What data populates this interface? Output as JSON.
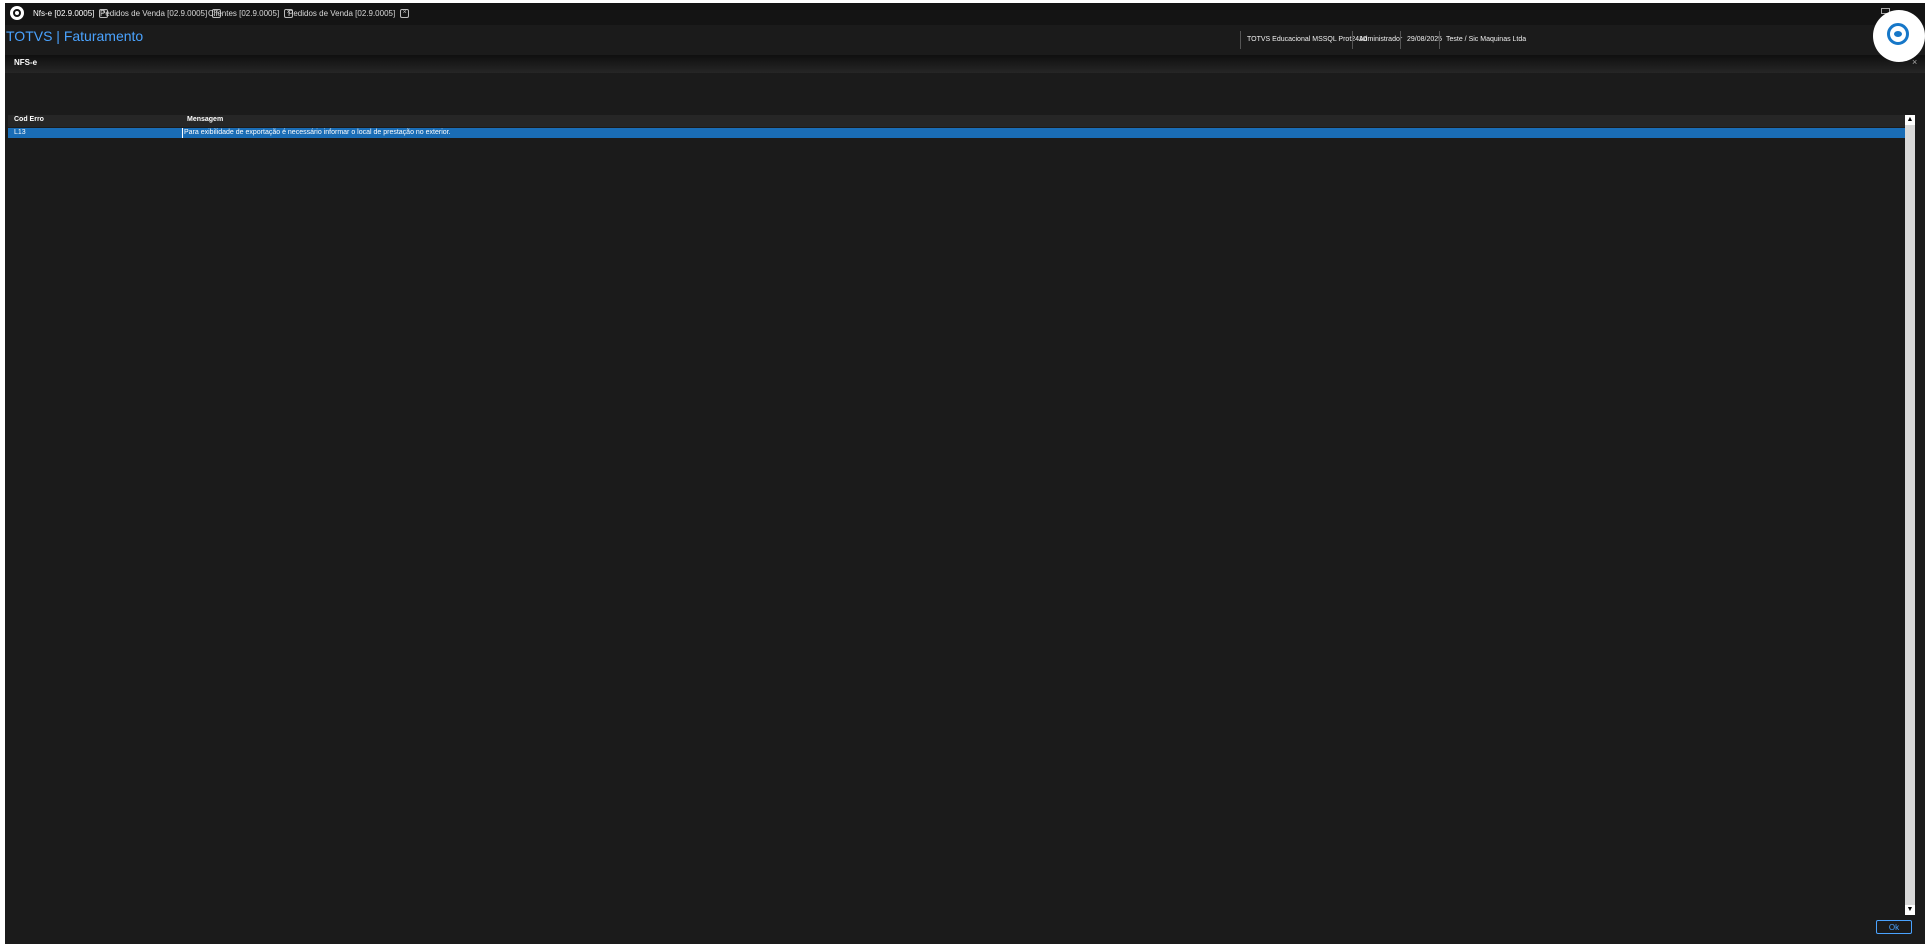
{
  "tabs": [
    {
      "label": "Nfs-e [02.9.0005]"
    },
    {
      "label": "Pedidos de Venda [02.9.0005]"
    },
    {
      "label": "Clientes [02.9.0005]"
    },
    {
      "label": "Pedidos de Venda [02.9.0005]"
    }
  ],
  "tab_close_glyph": "×",
  "header": {
    "title": "TOTVS | Faturamento",
    "environment": "TOTVS Educacional MSSQL Prot2410",
    "user": "Administrador",
    "date": "29/08/2025",
    "company": "Teste / Sic Maquinas Ltda"
  },
  "dialog": {
    "title": "NFS-e",
    "close_glyph": "×",
    "columns": {
      "code": "Cod Erro",
      "message": "Mensagem"
    },
    "rows": [
      {
        "code": "L13",
        "message": "Para exibilidade de exportação é necessário informar o local de prestação no exterior."
      }
    ],
    "ok_label": "Ok"
  },
  "scroll_up_glyph": "▲",
  "scroll_down_glyph": "▼",
  "colors": {
    "accent": "#4aa3ff",
    "selection": "#1a6db6",
    "background": "#1b1b1b"
  }
}
